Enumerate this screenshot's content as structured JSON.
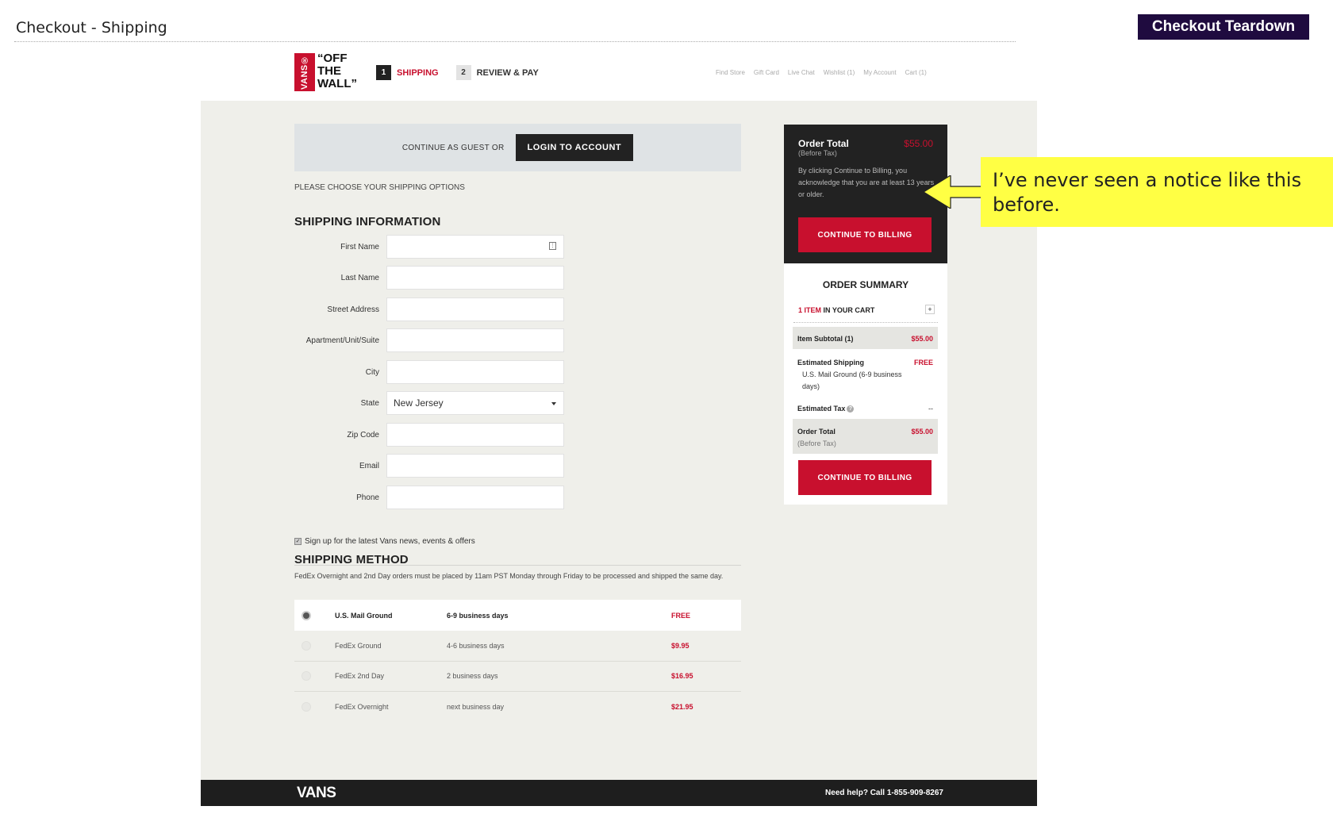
{
  "slide": {
    "title": "Checkout - Shipping",
    "badge": "Checkout Teardown"
  },
  "header": {
    "logo_mark": "VANS®",
    "logo_text": "“OFF\nTHE\nWALL”",
    "steps": [
      {
        "num": "1",
        "label": "SHIPPING"
      },
      {
        "num": "2",
        "label": "REVIEW & PAY"
      }
    ],
    "util_nav": [
      "Find Store",
      "Gift Card",
      "Live Chat",
      "Wishlist (1)",
      "My Account",
      "Cart (1)"
    ]
  },
  "guest_bar": {
    "text": "CONTINUE AS GUEST OR",
    "login_label": "LOGIN TO ACCOUNT"
  },
  "choose_text": "PLEASE CHOOSE YOUR SHIPPING OPTIONS",
  "shipping_info": {
    "title": "SHIPPING INFORMATION",
    "fields": [
      {
        "label": "First Name",
        "value": ""
      },
      {
        "label": "Last Name",
        "value": ""
      },
      {
        "label": "Street Address",
        "value": ""
      },
      {
        "label": "Apartment/Unit/Suite",
        "value": ""
      },
      {
        "label": "City",
        "value": ""
      },
      {
        "label": "State",
        "value": "New Jersey"
      },
      {
        "label": "Zip Code",
        "value": ""
      },
      {
        "label": "Email",
        "value": ""
      },
      {
        "label": "Phone",
        "value": ""
      }
    ],
    "signup_label": "Sign up for the latest Vans news, events & offers"
  },
  "shipping_method": {
    "title": "SHIPPING METHOD",
    "note": "FedEx Overnight and 2nd Day orders must be placed by 11am PST Monday through Friday to be processed and shipped the same day.",
    "options": [
      {
        "name": "U.S. Mail Ground",
        "time": "6-9 business days",
        "price": "FREE",
        "selected": true
      },
      {
        "name": "FedEx Ground",
        "time": "4-6 business days",
        "price": "$9.95",
        "selected": false
      },
      {
        "name": "FedEx 2nd Day",
        "time": "2 business days",
        "price": "$16.95",
        "selected": false
      },
      {
        "name": "FedEx Overnight",
        "time": "next business day",
        "price": "$21.95",
        "selected": false
      }
    ]
  },
  "order_total_box": {
    "title": "Order Total",
    "subtitle": "(Before Tax)",
    "price": "$55.00",
    "notice": "By clicking Continue to Billing, you acknowledge that you are at least 13 years or older.",
    "button_label": "CONTINUE TO BILLING"
  },
  "order_summary": {
    "title": "ORDER SUMMARY",
    "items_count": "1 ITEM",
    "items_suffix": " IN YOUR CART",
    "subtotal_label": "Item Subtotal (1)",
    "subtotal_value": "$55.00",
    "shipping_label": "Estimated Shipping",
    "shipping_value": "FREE",
    "shipping_detail": "U.S. Mail Ground (6-9 business days)",
    "tax_label": "Estimated Tax",
    "tax_value": "--",
    "total_label": "Order Total",
    "total_sub": "(Before Tax)",
    "total_value": "$55.00",
    "button_label": "CONTINUE TO BILLING"
  },
  "callout": {
    "text": "I’ve never seen a notice like this before."
  },
  "footer": {
    "logo": "VANS",
    "help": "Need help? Call 1-855-909-8267"
  },
  "colors": {
    "brand_red": "#c8102e",
    "badge_purple": "#1f0b3f",
    "callout_yellow": "#ffff44"
  }
}
